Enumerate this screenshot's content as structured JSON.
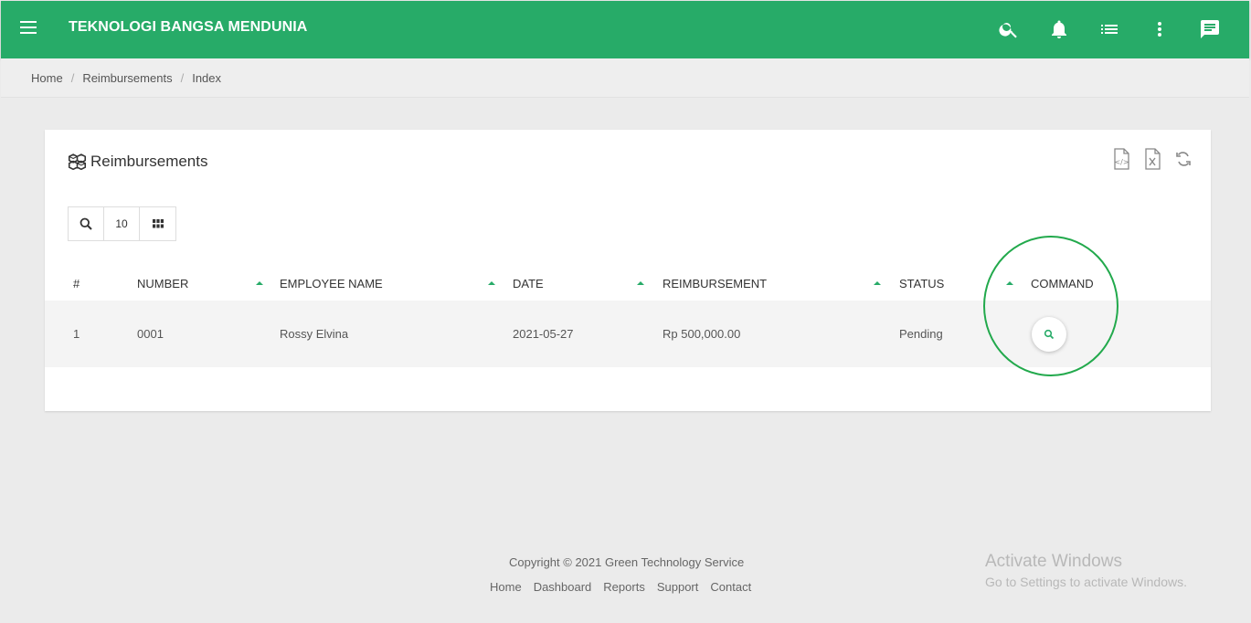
{
  "header": {
    "app_title": "TEKNOLOGI BANGSA MENDUNIA",
    "brand_color": "#27ab68",
    "icons": [
      "menu-icon",
      "search-icon",
      "bell-icon",
      "list-icon",
      "more-vert-icon",
      "chat-icon"
    ]
  },
  "breadcrumb": [
    "Home",
    "Reimbursements",
    "Index"
  ],
  "card": {
    "title": "Reimbursements",
    "tools": [
      "export-pdf-icon",
      "export-excel-icon",
      "refresh-icon"
    ],
    "page_size": "10"
  },
  "table": {
    "columns": [
      "#",
      "NUMBER",
      "EMPLOYEE NAME",
      "DATE",
      "REIMBURSEMENT",
      "STATUS",
      "COMMAND"
    ],
    "rows": [
      {
        "index": "1",
        "number": "0001",
        "employee": "Rossy Elvina",
        "date": "2021-05-27",
        "amount": "Rp 500,000.00",
        "status": "Pending"
      }
    ]
  },
  "footer": {
    "copyright": "Copyright © 2021 Green Technology Service",
    "links": [
      "Home",
      "Dashboard",
      "Reports",
      "Support",
      "Contact"
    ]
  },
  "watermark": {
    "line1": "Activate Windows",
    "line2": "Go to Settings to activate Windows."
  }
}
